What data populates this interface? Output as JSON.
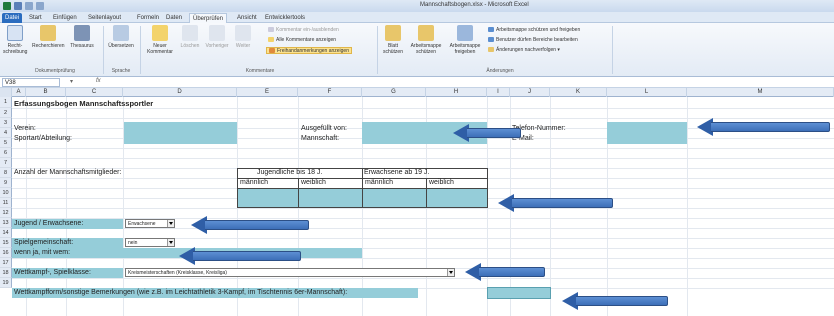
{
  "window": {
    "title": "Mannschaftsbogen.xlsx - Microsoft Excel"
  },
  "tabs": [
    "Datei",
    "Start",
    "Einfügen",
    "Seitenlayout",
    "Formeln",
    "Daten",
    "Überprüfen",
    "Ansicht",
    "Entwicklertools"
  ],
  "ribbon": {
    "proofing": {
      "spell": "Recht-\nschreibung",
      "research": "Recherchieren",
      "thesaurus": "Thesaurus",
      "label": "Dokumentprüfung"
    },
    "language": {
      "translate": "Übersetzen",
      "label": "Sprache"
    },
    "comments": {
      "new": "Neuer\nKommentar",
      "delete": "Löschen",
      "prev": "Vorheriger",
      "next": "Weiter",
      "show_hide": "Kommentar ein-/ausblenden",
      "show_all": "Alle Kommentare anzeigen",
      "ink": "Freihandanmerkungen anzeigen",
      "label": "Kommentare"
    },
    "changes": {
      "protect_sheet": "Blatt\nschützen",
      "protect_wb": "Arbeitsmappe\nschützen",
      "share_wb": "Arbeitsmappe\nfreigeben",
      "protect_share": "Arbeitsmappe schützen und freigeben",
      "allow_edit": "Benutzer dürfen Bereiche bearbeiten",
      "track": "Änderungen nachverfolgen",
      "label": "Änderungen"
    }
  },
  "formula_bar": {
    "name_box": "V38",
    "fx": "fx"
  },
  "columns": [
    "A",
    "B",
    "C",
    "D",
    "E",
    "F",
    "G",
    "H",
    "I",
    "J",
    "K",
    "L",
    "M"
  ],
  "rows": [
    "1",
    "2",
    "3",
    "4",
    "5",
    "6",
    "7",
    "8",
    "9",
    "10",
    "11",
    "12",
    "13",
    "14",
    "15",
    "16",
    "17",
    "18",
    "19"
  ],
  "sheet": {
    "title": "Erfassungsbogen Mannschaftssportler",
    "verein": "Verein:",
    "sportart": "Sportart/Abteilung:",
    "ausgefuellt": "Ausgefüllt von:",
    "mannschaft": "Mannschaft:",
    "telefon": "Telefon-Nummer:",
    "email": "E-Mail:",
    "anzahl": "Anzahl der Mannschaftsmitglieder:",
    "jugend_header": "Jugendliche bis 18 J.",
    "erwachsene_header": "Erwachsene ab 19 J.",
    "maennlich": "männlich",
    "weiblich": "weiblich",
    "jugend_erw": "Jugend / Erwachsene:",
    "jugend_erw_value": "Erwachsene",
    "spielgemeinschaft": "Spielgemeinschaft:",
    "spielgemeinschaft_value": "nein",
    "wenn_ja": "wenn ja, mit wem:",
    "wettkampf_spielklasse": "Wettkampf-, Spielklasse:",
    "wettkampf_value": "Kreismeisterschaften (Kreisklasse, Kreisliga)",
    "wettkampfform": "Wettkampfform/sonstige Bemerkungen (wie z.B. im Leichtathletik 3-Kampf, im Tischtennis 6er-Mannschaft):"
  },
  "colors": {
    "input_fill": "#95cdd9",
    "arrow": "#3d6fb8",
    "file_tab": "#2a6cbf"
  }
}
